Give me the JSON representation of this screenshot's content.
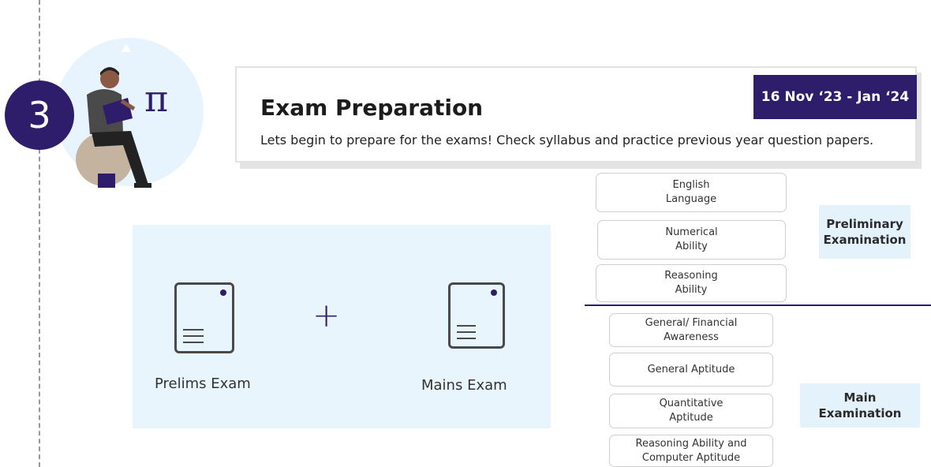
{
  "step": {
    "number": "3"
  },
  "illustration": {
    "symbol": "π"
  },
  "header": {
    "title": "Exam Preparation",
    "description": "Lets begin to prepare for the exams! Check syllabus and practice previous year question papers.",
    "date_range": "16 Nov ‘23 - Jan ‘24"
  },
  "exams": {
    "plus_symbol": "+",
    "prelims_label": "Prelims Exam",
    "mains_label": "Mains Exam"
  },
  "preliminary": {
    "section_label": "Preliminary\nExamination",
    "subjects": [
      "English\nLanguage",
      "Numerical\nAbility",
      "Reasoning\nAbility"
    ]
  },
  "main": {
    "section_label": "Main\nExamination",
    "subjects": [
      "General/ Financial\nAwareness",
      "General Aptitude",
      "Quantitative\nAptitude",
      "Reasoning Ability and\nComputer Aptitude"
    ]
  },
  "colors": {
    "primary": "#2e1d6a",
    "light_blue": "#e9f5fd",
    "border": "#cfcfcf"
  },
  "icons": [
    "step-number-badge",
    "reader-illustration",
    "pi-symbol",
    "document-icon",
    "plus-icon"
  ]
}
